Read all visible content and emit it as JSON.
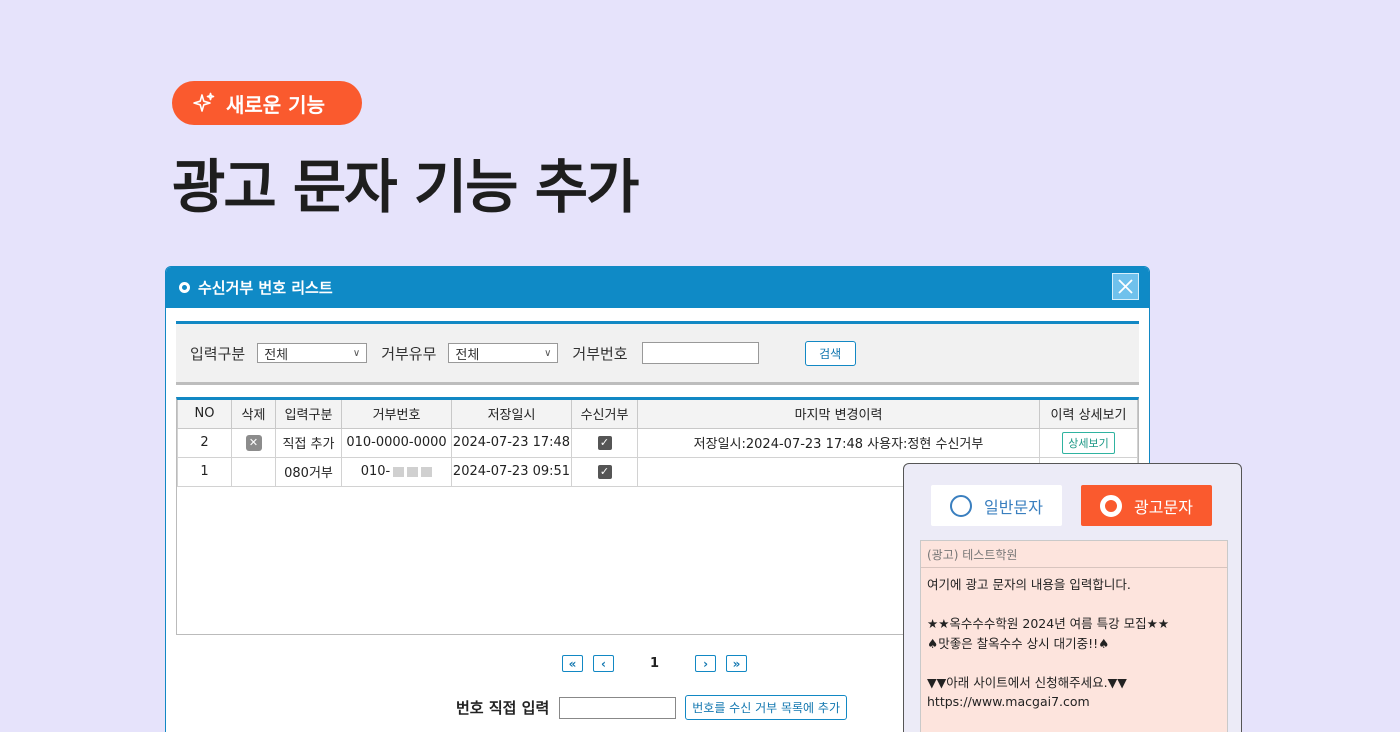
{
  "badge": {
    "label": "새로운 기능",
    "icon": "sparkle-icon"
  },
  "headline": "광고 문자 기능 추가",
  "window": {
    "title": "수신거부 번호 리스트",
    "filters": {
      "input_type_label": "입력구분",
      "input_type_value": "전체",
      "refuse_label": "거부유무",
      "refuse_value": "전체",
      "number_label": "거부번호",
      "search_button": "검색"
    },
    "table": {
      "headers": [
        "NO",
        "삭제",
        "입력구분",
        "거부번호",
        "저장일시",
        "수신거부",
        "마지막 변경이력",
        "이력 상세보기"
      ],
      "rows": [
        {
          "no": "2",
          "type": "직접 추가",
          "number": "010-0000-0000",
          "saved": "2024-07-23 17:48",
          "history": "저장일시:2024-07-23 17:48 사용자:정현 수신거부",
          "detail": "상세보기"
        },
        {
          "no": "1",
          "type": "080거부",
          "number": "010-",
          "saved": "2024-07-23 09:51",
          "history": "",
          "detail": ""
        }
      ]
    },
    "pager": {
      "current": "1"
    },
    "direct_input": {
      "label": "번호 직접 입력",
      "button": "번호를 수신 거부 목록에 추가"
    }
  },
  "sms_panel": {
    "option_normal": "일반문자",
    "option_ad": "광고문자",
    "selected": "광고문자",
    "message_header": "(광고) 테스트학원",
    "message_body": "여기에 광고 문자의 내용을 입력합니다.\n\n★★옥수수수학원 2024년 여름 특강 모집★★\n♠맛좋은 찰옥수수 상시 대기중!!♠\n\n▼▼아래 사이트에서 신청해주세요.▼▼\nhttps://www.macgai7.com"
  },
  "colors": {
    "accent": "#fa5a2e",
    "window_blue": "#0f8ac6",
    "background": "#e6e3fb",
    "message_bg": "#fde4dd"
  }
}
